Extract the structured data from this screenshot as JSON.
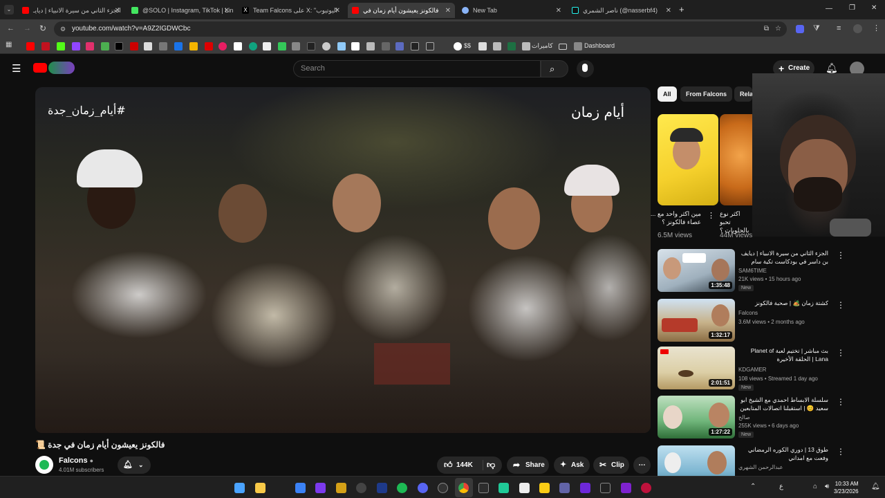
{
  "browser": {
    "tabs": [
      {
        "title": "الجزء الثاني من سيرة الانبياء | ديايـ",
        "favicon": "youtube-icon"
      },
      {
        "title": "@SOLO | Instagram, TikTok | Lin",
        "favicon": "linktree-icon"
      },
      {
        "title": "Team Falcons على X: \"اليوتيوب",
        "favicon": "x-icon"
      },
      {
        "title": "فالكونز يعيشون أيام زمان في",
        "favicon": "youtube-icon",
        "active": true
      },
      {
        "title": "New Tab",
        "favicon": "chrome-icon"
      },
      {
        "title": "ناصر الشمري (@nasserbf4)",
        "favicon": "tiktok-icon"
      }
    ],
    "new_tab": "+",
    "url": "youtube.com/watch?v=A9Z2IGDWCbc",
    "bookmarks": {
      "folder1": "كاميرات",
      "folder2": "Dashboard",
      "dollar": "$$"
    }
  },
  "youtube": {
    "search_placeholder": "Search",
    "create_label": "Create",
    "video": {
      "title": "فالكونز يعيشون أيام زمان في جدة 📜",
      "watermark_left": "#أيام_زمان_جدة",
      "watermark_right": "أيام زمان"
    },
    "channel": {
      "name": "Falcons",
      "subscribers": "4.01M subscribers"
    },
    "actions": {
      "likes": "144K",
      "share": "Share",
      "ask": "Ask",
      "clip": "Clip"
    },
    "chips": [
      "All",
      "From Falcons",
      "Rela"
    ],
    "shorts": [
      {
        "title": "مين اكثر واحد مع ... عصاء فالكونز ؟",
        "views": "6.5M views"
      },
      {
        "title": "اكثر نوع تحبو بالحلويات ؟",
        "views": "44M views"
      }
    ],
    "recommended": [
      {
        "title": "الجزء الثاني من سيرة الانبياء | ديايف بن داسر في بودكاست تكية سام",
        "channel": "SAM6TIME",
        "meta": "21K views • 15 hours ago",
        "badge": "New",
        "duration": "1:35:48"
      },
      {
        "title": "كشتة زمان 🏕️ | صحبة فالكونز",
        "channel": "Falcons",
        "meta": "3.6M views • 2 months ago",
        "badge": "",
        "duration": "1:32:17"
      },
      {
        "title": "بث مباشر | تختيم لعبة Planet of Lana | الحلقة الأخيرة",
        "channel": "KDGAMER",
        "meta": "108 views • Streamed 1 day ago",
        "badge": "New",
        "duration": "2:01:51"
      },
      {
        "title": "سلسلة الابساط احمدي مع الشيخ ابو سعيد 😊 | استقبلنا اتصالات المتابعين 📜 #4 ...",
        "channel": "صالح",
        "meta": "255K views • 6 days ago",
        "badge": "New",
        "duration": "1:27:22"
      },
      {
        "title": "طوق 13 | دوري الكوره الرمضاني وفعت مع امداني",
        "channel": "عبدالرحمن الشهري",
        "meta": "",
        "badge": "",
        "duration": ""
      }
    ]
  },
  "taskbar": {
    "time": "10:33 AM",
    "date": "3/23/2026",
    "lang": "ع"
  }
}
